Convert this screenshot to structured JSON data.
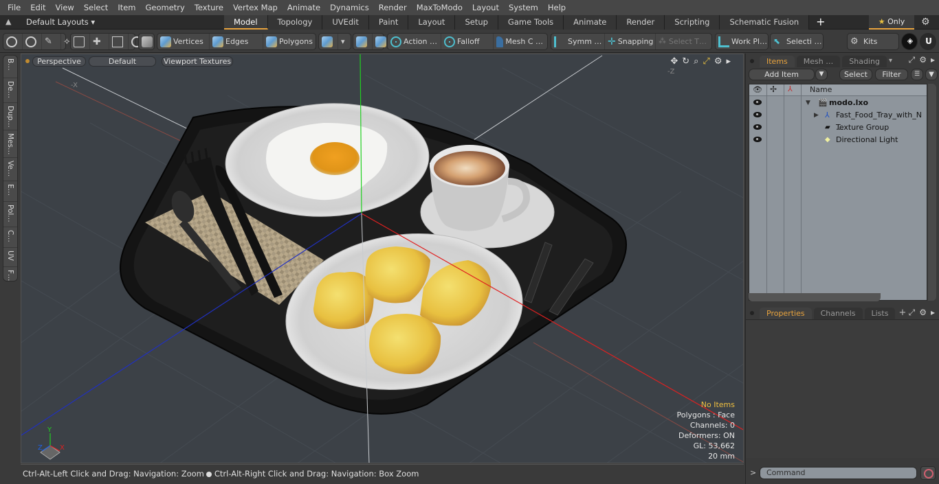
{
  "menu": [
    "File",
    "Edit",
    "View",
    "Select",
    "Item",
    "Geometry",
    "Texture",
    "Vertex Map",
    "Animate",
    "Dynamics",
    "Render",
    "MaxToModo",
    "Layout",
    "System",
    "Help"
  ],
  "layouts": {
    "label": "Default Layouts ▾"
  },
  "layout_tabs": [
    {
      "label": "Model",
      "active": true
    },
    {
      "label": "Topology"
    },
    {
      "label": "UVEdit"
    },
    {
      "label": "Paint"
    },
    {
      "label": "Layout"
    },
    {
      "label": "Setup"
    },
    {
      "label": "Game Tools"
    },
    {
      "label": "Animate"
    },
    {
      "label": "Render"
    },
    {
      "label": "Scripting"
    },
    {
      "label": "Schematic Fusion"
    }
  ],
  "tabbar": {
    "add": "+",
    "only": "Only",
    "star": "★",
    "gear": "⚙"
  },
  "toolbar": {
    "vertices": "Vertices",
    "edges": "Edges",
    "polygons": "Polygons",
    "action": "Action …",
    "falloff": "Falloff",
    "mesh_c": "Mesh C …",
    "symm": "Symm …",
    "snapping": "Snapping",
    "select_t": "Select T…",
    "work_pl": "Work Pl…",
    "selecti": "Selecti …",
    "kits": "Kits"
  },
  "left_tabs": [
    "B…",
    "De…",
    "Dup…",
    "Mes…",
    "Ve…",
    "E…",
    "Pol…",
    "C…",
    "UV",
    "F…"
  ],
  "viewport": {
    "view": "Perspective",
    "shading": "Default",
    "textures": "Viewport Textures",
    "axis_neg_x": "-X",
    "axis_neg_z": "-Z",
    "info": {
      "selection": "No Items",
      "polygons": "Polygons : Face",
      "channels": "Channels: 0",
      "deformers": "Deformers: ON",
      "gl": "GL: 53,662",
      "scale": "20 mm"
    },
    "gizmo": {
      "x": "X",
      "y": "Y",
      "z": "Z"
    },
    "colors": {
      "x_axis": "#e02020",
      "y_axis": "#20d020",
      "z_axis": "#2030c0",
      "highlight": "#f0c040"
    }
  },
  "status": {
    "left": "Ctrl-Alt-Left Click and Drag: Navigation: Zoom",
    "right": "Ctrl-Alt-Right Click and Drag: Navigation: Box Zoom"
  },
  "items_panel": {
    "tabs": [
      {
        "label": "Items",
        "active": true
      },
      {
        "label": "Mesh …"
      },
      {
        "label": "Shading"
      }
    ],
    "add_item": "Add Item",
    "select": "Select",
    "filter": "Filter",
    "column_name": "Name",
    "tree": [
      {
        "label": "modo.lxo",
        "depth": 0,
        "bold": true,
        "icon": "scene-clapper-icon",
        "expanded": true
      },
      {
        "label": "Fast_Food_Tray_with_N …",
        "depth": 1,
        "icon": "mesh-locator-icon",
        "collapsed": true
      },
      {
        "label": "Texture Group",
        "depth": 1,
        "icon": "texture-group-icon"
      },
      {
        "label": "Directional Light",
        "depth": 1,
        "icon": "light-icon"
      }
    ]
  },
  "properties_panel": {
    "tabs": [
      {
        "label": "Properties",
        "active": true
      },
      {
        "label": "Channels"
      },
      {
        "label": "Lists"
      }
    ],
    "add": "+"
  },
  "command": {
    "prompt": ">",
    "placeholder": "Command"
  }
}
